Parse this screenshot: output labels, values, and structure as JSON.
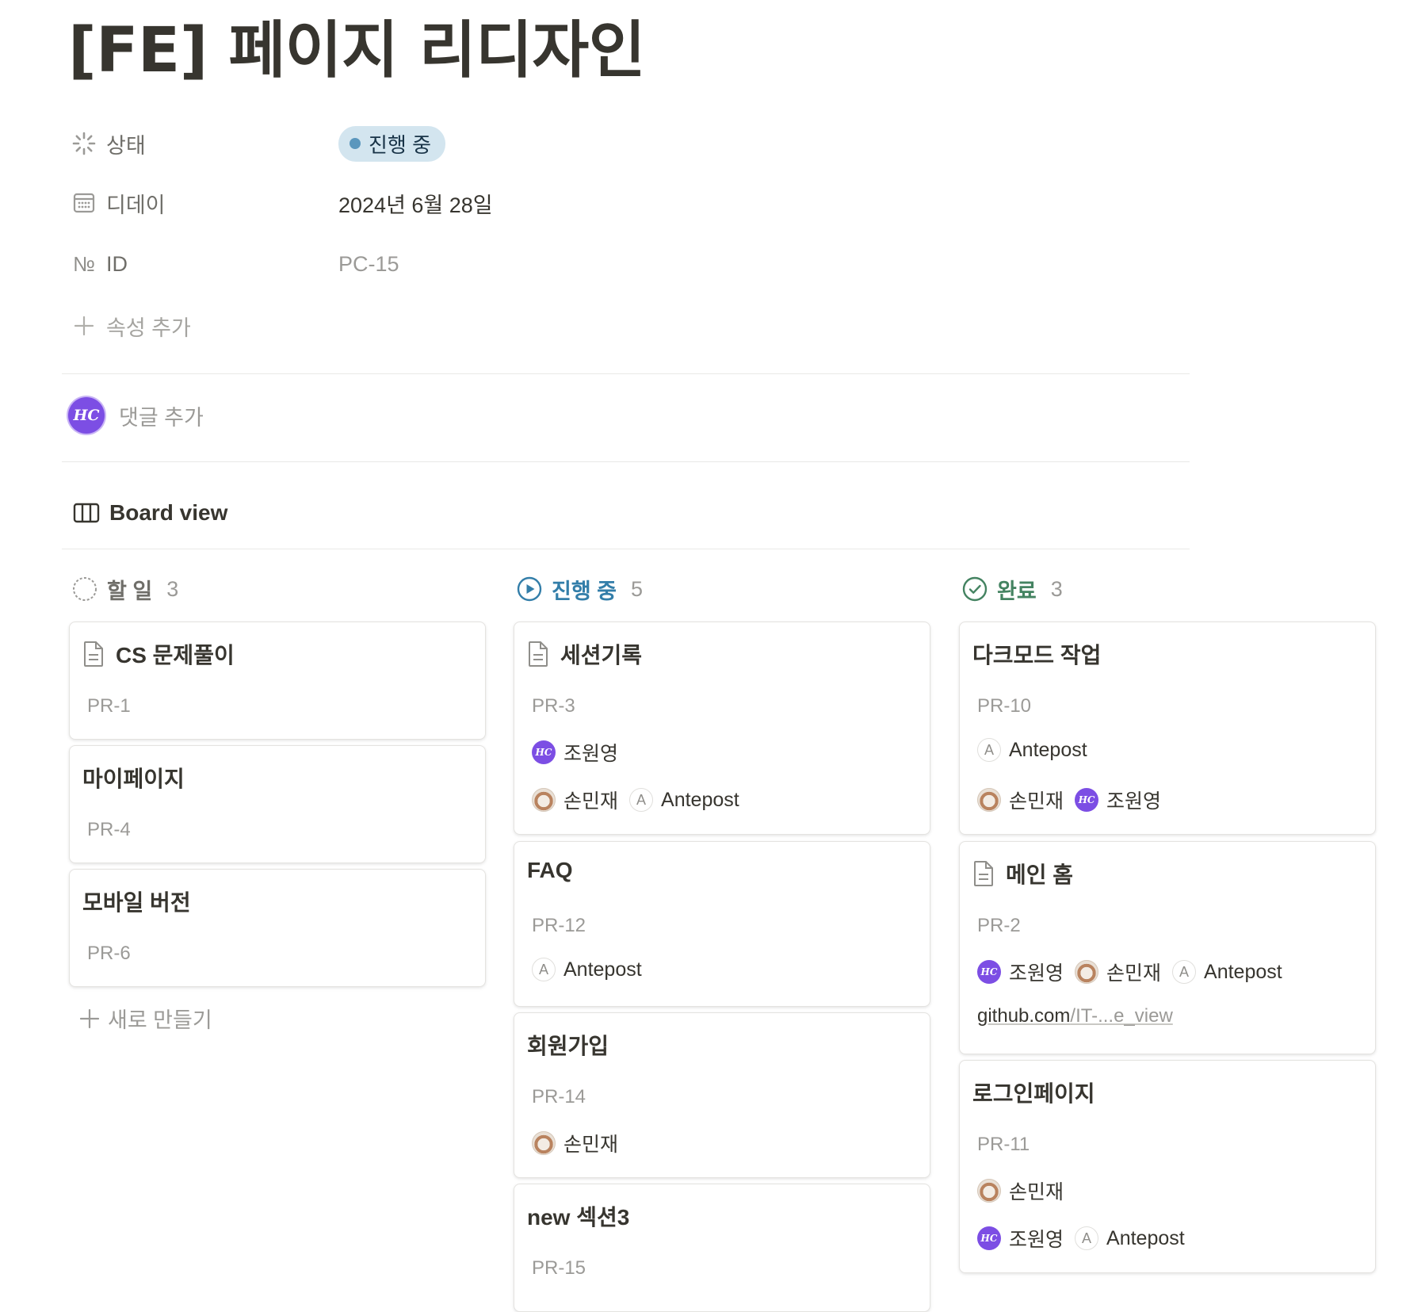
{
  "page": {
    "title": "[FE] 페이지 리디자인"
  },
  "properties": {
    "status": {
      "label": "상태",
      "value": "진행 중"
    },
    "due": {
      "label": "디데이",
      "value": "2024년 6월 28일"
    },
    "id": {
      "label": "ID",
      "icon_text": "№",
      "value": "PC-15"
    },
    "add_property": "속성 추가"
  },
  "comment": {
    "avatar_text": "HC",
    "placeholder": "댓글 추가"
  },
  "view": {
    "label": "Board view"
  },
  "colors": {
    "status_blue": "#5b97bd",
    "status_pill_bg": "#d3e5ef",
    "done_green": "#448361",
    "avatar_purple": "#7c4ee4",
    "inprogress_text": "#337ea9"
  },
  "people": {
    "hc": "조원영",
    "cat": "손민재",
    "a": "Antepost",
    "a_initial": "A",
    "hc_initial": "HC"
  },
  "board": {
    "columns": [
      {
        "name": "할 일",
        "count": "3",
        "cards": [
          {
            "title": "CS 문제풀이",
            "id": "PR-1"
          },
          {
            "title": "마이페이지",
            "id": "PR-4"
          },
          {
            "title": "모바일 버전",
            "id": "PR-6"
          }
        ],
        "new_label": "새로 만들기"
      },
      {
        "name": "진행 중",
        "count": "5",
        "cards": [
          {
            "title": "세션기록",
            "id": "PR-3"
          },
          {
            "title": "FAQ",
            "id": "PR-12"
          },
          {
            "title": "회원가입",
            "id": "PR-14"
          },
          {
            "title": "new 섹션3",
            "id": "PR-15"
          }
        ]
      },
      {
        "name": "완료",
        "count": "3",
        "cards": [
          {
            "title": "다크모드 작업",
            "id": "PR-10"
          },
          {
            "title": "메인 홈",
            "id": "PR-2",
            "link_host": "github.com",
            "link_rest": "/IT-...e_view"
          },
          {
            "title": "로그인페이지",
            "id": "PR-11"
          }
        ]
      }
    ]
  }
}
